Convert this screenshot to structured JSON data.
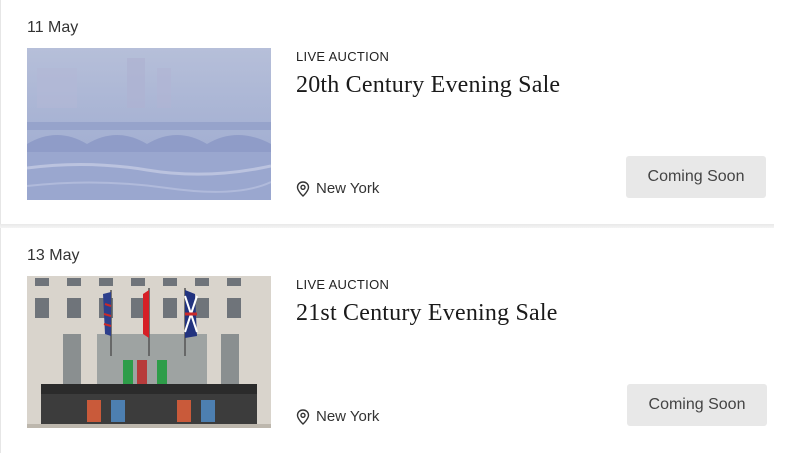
{
  "auctions": [
    {
      "date": "11 May",
      "type": "LIVE AUCTION",
      "title": "20th Century Evening Sale",
      "location": "New York",
      "button_label": "Coming Soon",
      "image_icon": "painting-image"
    },
    {
      "date": "13 May",
      "type": "LIVE AUCTION",
      "title": "21st Century Evening Sale",
      "location": "New York",
      "button_label": "Coming Soon",
      "image_icon": "building-image"
    }
  ],
  "colors": {
    "button_bg": "#e8e8e8",
    "button_text": "#444444",
    "divider": "#eeeeee"
  }
}
